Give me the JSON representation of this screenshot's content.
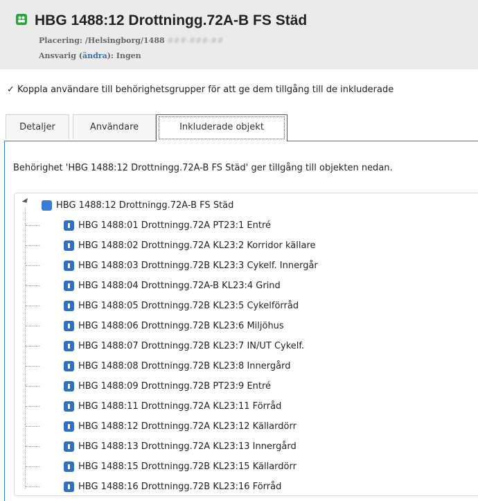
{
  "header": {
    "title": "HBG 1488:12 Drottningg.72A-B FS Städ",
    "location_label": "Placering: /Helsingborg/1488",
    "location_redacted": "###-###-##",
    "responsible_prefix": "Ansvarig (",
    "responsible_link": "ändra",
    "responsible_suffix": "): Ingen",
    "icon": "group-icon",
    "icon_color": "#2aa53a"
  },
  "notice": "✓ Koppla användare till behörighetsgrupper för att ge dem tillgång till de inkluderade",
  "tabs": [
    {
      "label": "Detaljer",
      "active": false
    },
    {
      "label": "Användare",
      "active": false
    },
    {
      "label": "Inkluderade objekt",
      "active": true
    }
  ],
  "permission_text": "Behörighet 'HBG 1488:12 Drottningg.72A-B FS Städ' ger tillgång till objekten nedan.",
  "tree": {
    "root": {
      "label": "HBG 1488:12 Drottningg.72A-B FS Städ",
      "icon": "group-icon"
    },
    "children": [
      "HBG 1488:01 Drottningg.72A PT23:1 Entré",
      "HBG 1488:02 Drottningg.72A KL23:2 Korridor källare",
      "HBG 1488:03 Drottningg.72B KL23:3 Cykelf. Innergår",
      "HBG 1488:04 Drottningg.72A-B KL23:4 Grind",
      "HBG 1488:05 Drottningg.72B KL23:5 Cykelförråd",
      "HBG 1488:06 Drottningg.72B KL23:6 Miljöhus",
      "HBG 1488:07 Drottningg.72B KL23:7 IN/UT Cykelf.",
      "HBG 1488:08 Drottningg.72B KL23:8 Innergård",
      "HBG 1488:09 Drottningg.72B PT23:9 Entré",
      "HBG 1488:11 Drottningg.72A KL23:11 Förråd",
      "HBG 1488:12 Drottningg.72A KL23:12 Källardörr",
      "HBG 1488:13 Drottningg.72A KL23:13 Innergård",
      "HBG 1488:15 Drottningg.72B KL23:15 Källardörr",
      "HBG 1488:16 Drottningg.72B KL23:16 Förråd"
    ],
    "child_icon": "door-icon",
    "accent": "#2d79c7"
  }
}
